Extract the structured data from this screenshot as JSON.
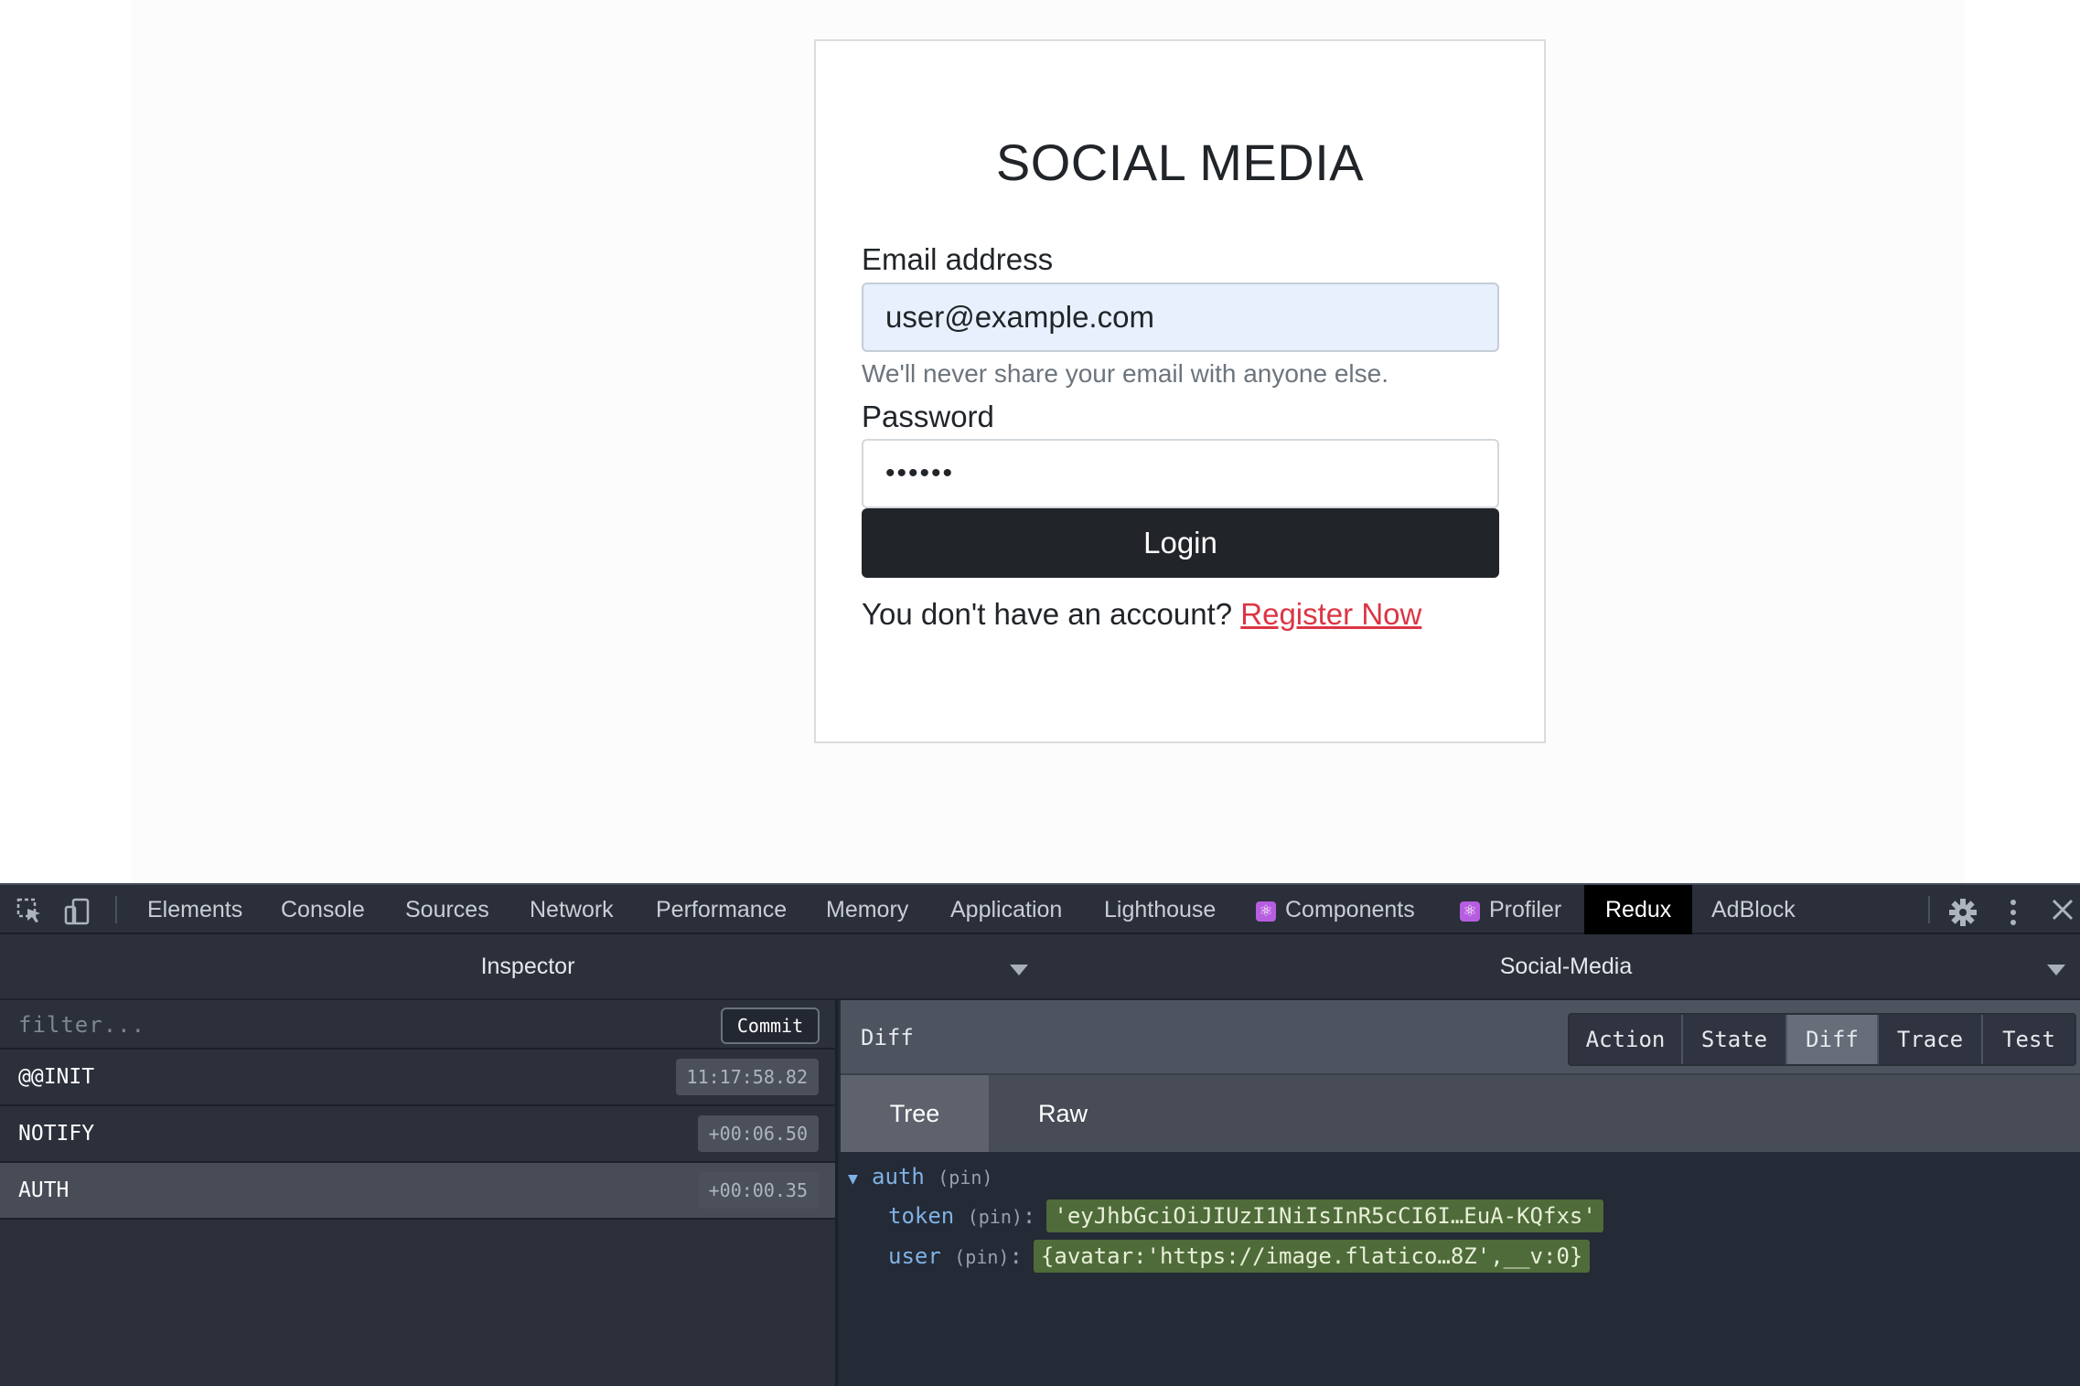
{
  "page": {
    "title": "SOCIAL MEDIA",
    "email_label": "Email address",
    "email_value": "user@example.com",
    "email_help": "We'll never share your email with anyone else.",
    "password_label": "Password",
    "password_value": "••••••",
    "login_label": "Login",
    "register_prompt": "You don't have an account?",
    "register_link": "Register Now",
    "colors": {
      "button": "#212529",
      "link": "#dc3545",
      "autofill": "#e8f0fe"
    }
  },
  "devtools": {
    "icons": [
      "inspect-element-icon",
      "device-toolbar-icon",
      "settings-gear-icon",
      "more-vertical-icon",
      "close-icon"
    ],
    "tabs": {
      "elements": "Elements",
      "console": "Console",
      "sources": "Sources",
      "network": "Network",
      "performance": "Performance",
      "memory": "Memory",
      "application": "Application",
      "lighthouse": "Lighthouse",
      "components": "Components",
      "profiler": "Profiler",
      "redux": "Redux",
      "adblock": "AdBlock"
    },
    "active_tab": "Redux"
  },
  "redux": {
    "monitor": "Inspector",
    "instance": "Social-Media",
    "filter_placeholder": "filter...",
    "commit_label": "Commit",
    "actions": [
      {
        "name": "@@INIT",
        "time": "11:17:58.82"
      },
      {
        "name": "NOTIFY",
        "time": "+00:06.50"
      },
      {
        "name": "AUTH",
        "time": "+00:00.35",
        "selected": true
      }
    ],
    "panel_title": "Diff",
    "monitor_tabs": [
      "Action",
      "State",
      "Diff",
      "Trace",
      "Test"
    ],
    "active_monitor_tab": "Diff",
    "view_tabs": [
      "Tree",
      "Raw"
    ],
    "active_view_tab": "Tree",
    "tree": {
      "root_key": "auth",
      "pin": "(pin)",
      "token_key": "token",
      "token_value": "'eyJhbGciOiJIUzI1NiIsInR5cCI6I…EuA-KQfxs'",
      "user_key": "user",
      "user_value": "{avatar:'https://image.flatico…8Z',__v:0}"
    }
  }
}
